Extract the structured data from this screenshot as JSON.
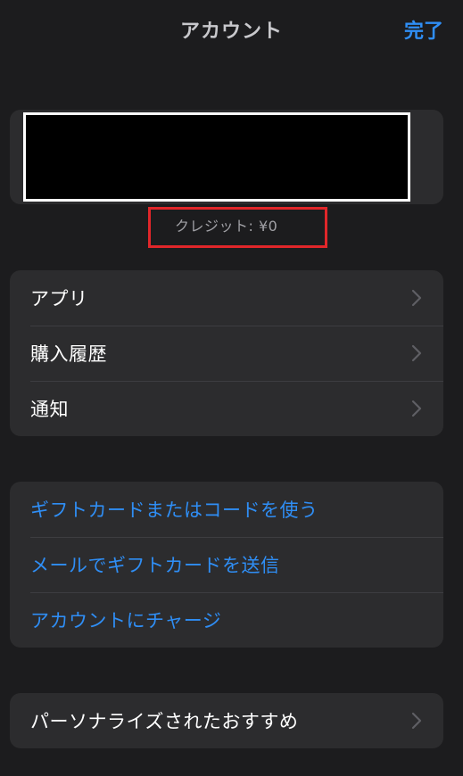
{
  "header": {
    "title": "アカウント",
    "done_label": "完了"
  },
  "account": {
    "credit_text": "クレジット: ¥0"
  },
  "groups": [
    {
      "rows": [
        {
          "label": "アプリ"
        },
        {
          "label": "購入履歴"
        },
        {
          "label": "通知"
        }
      ]
    },
    {
      "rows": [
        {
          "label": "ギフトカードまたはコードを使う"
        },
        {
          "label": "メールでギフトカードを送信"
        },
        {
          "label": "アカウントにチャージ"
        }
      ]
    },
    {
      "rows": [
        {
          "label": "パーソナライズされたおすすめ"
        }
      ]
    }
  ],
  "colors": {
    "background": "#1c1c1e",
    "cell": "#2c2c2e",
    "accent": "#2f8ef5",
    "highlight": "#e0262a",
    "chevron": "#5f5f64"
  },
  "icons": {
    "disclosure": "chevron-right-icon"
  }
}
